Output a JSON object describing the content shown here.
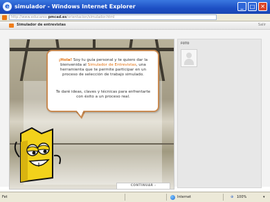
{
  "window": {
    "title": "simulador - Windows Internet Explorer",
    "buttons": {
      "minimize": "_",
      "maximize": "□",
      "close": "✕"
    }
  },
  "address": {
    "prefix": "http://www.educarex.",
    "domain": "pmcad.es",
    "suffix": "/orientacion/simulador.html"
  },
  "app": {
    "title": "Simulador de entrevistas",
    "right_label": "Salir"
  },
  "photo_panel": {
    "label": "FOTO"
  },
  "bubble": {
    "greeting": "¡Hola!",
    "text1": " Soy tu guía personal y te quiero dar la bienvenida al ",
    "highlight": "Simulador de Entrevistas",
    "text2": ", una herramienta que te permite participar en un proceso de selección de trabajo simulado.",
    "paragraph2": "Te daré ideas, claves y técnicas para enfrentarte con éxito a un proceso real."
  },
  "continue_button": {
    "label": "CONTINUAR  ›"
  },
  "status": {
    "left": "Fet",
    "zone": "Internet",
    "zoom": "100%"
  },
  "colors": {
    "accent": "#e07010",
    "titlebar": "#1d4fc4",
    "bubble_border": "#c88a52",
    "mascot": "#f2d21b"
  }
}
